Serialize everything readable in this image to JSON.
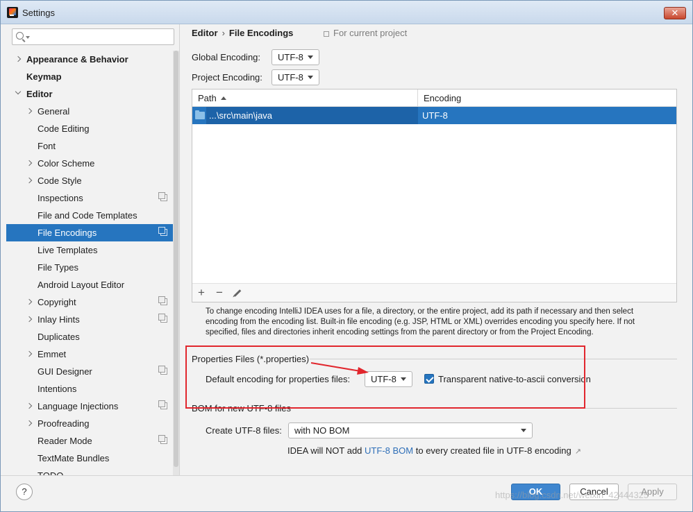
{
  "window": {
    "title": "Settings"
  },
  "search": {
    "placeholder": ""
  },
  "sidebar": {
    "items": [
      {
        "label": "Appearance & Behavior",
        "level": 0,
        "chevron": "right",
        "bold": true
      },
      {
        "label": "Keymap",
        "level": 0,
        "chevron": "none",
        "bold": true
      },
      {
        "label": "Editor",
        "level": 0,
        "chevron": "down",
        "bold": true
      },
      {
        "label": "General",
        "level": 1,
        "chevron": "right"
      },
      {
        "label": "Code Editing",
        "level": 1,
        "chevron": "none"
      },
      {
        "label": "Font",
        "level": 1,
        "chevron": "none"
      },
      {
        "label": "Color Scheme",
        "level": 1,
        "chevron": "right"
      },
      {
        "label": "Code Style",
        "level": 1,
        "chevron": "right"
      },
      {
        "label": "Inspections",
        "level": 1,
        "chevron": "none",
        "project": true
      },
      {
        "label": "File and Code Templates",
        "level": 1,
        "chevron": "none"
      },
      {
        "label": "File Encodings",
        "level": 1,
        "chevron": "none",
        "project": true,
        "selected": true
      },
      {
        "label": "Live Templates",
        "level": 1,
        "chevron": "none"
      },
      {
        "label": "File Types",
        "level": 1,
        "chevron": "none"
      },
      {
        "label": "Android Layout Editor",
        "level": 1,
        "chevron": "none"
      },
      {
        "label": "Copyright",
        "level": 1,
        "chevron": "right",
        "project": true
      },
      {
        "label": "Inlay Hints",
        "level": 1,
        "chevron": "right",
        "project": true
      },
      {
        "label": "Duplicates",
        "level": 1,
        "chevron": "none"
      },
      {
        "label": "Emmet",
        "level": 1,
        "chevron": "right"
      },
      {
        "label": "GUI Designer",
        "level": 1,
        "chevron": "none",
        "project": true
      },
      {
        "label": "Intentions",
        "level": 1,
        "chevron": "none"
      },
      {
        "label": "Language Injections",
        "level": 1,
        "chevron": "right",
        "project": true
      },
      {
        "label": "Proofreading",
        "level": 1,
        "chevron": "right"
      },
      {
        "label": "Reader Mode",
        "level": 1,
        "chevron": "none",
        "project": true
      },
      {
        "label": "TextMate Bundles",
        "level": 1,
        "chevron": "none"
      },
      {
        "label": "TODO",
        "level": 1,
        "chevron": "none"
      }
    ]
  },
  "breadcrumb": {
    "parent": "Editor",
    "separator": "›",
    "current": "File Encodings"
  },
  "scope_hint": "For current project",
  "global_encoding": {
    "label": "Global Encoding:",
    "value": "UTF-8"
  },
  "project_encoding": {
    "label": "Project Encoding:",
    "value": "UTF-8"
  },
  "table": {
    "columns": [
      "Path",
      "Encoding"
    ],
    "rows": [
      {
        "path": "...\\src\\main\\java",
        "encoding": "UTF-8"
      }
    ],
    "toolbar": {
      "add": "+",
      "remove": "−"
    }
  },
  "help_text": "To change encoding IntelliJ IDEA uses for a file, a directory, or the entire project, add its path if necessary and then select encoding from the encoding list. Built-in file encoding (e.g. JSP, HTML or XML) overrides encoding you specify here. If not specified, files and directories inherit encoding settings from the parent directory or from the Project Encoding.",
  "properties": {
    "section_title": "Properties Files (*.properties)",
    "default_label": "Default encoding for properties files:",
    "default_value": "UTF-8",
    "native_to_ascii_label": "Transparent native-to-ascii conversion",
    "native_to_ascii_checked": true
  },
  "bom": {
    "section_title": "BOM for new UTF-8 files",
    "create_label": "Create UTF-8 files:",
    "create_value": "with NO BOM",
    "note_prefix": "IDEA will NOT add",
    "note_link": "UTF-8 BOM",
    "note_suffix": "to every created file in UTF-8 encoding",
    "note_arrow": "↗"
  },
  "footer": {
    "help": "?",
    "ok": "OK",
    "cancel": "Cancel",
    "apply": "Apply",
    "watermark": "https://blog.csdn.net/weixin_42444325"
  },
  "colors": {
    "accent": "#2675bf",
    "annotation": "#e1262d"
  }
}
